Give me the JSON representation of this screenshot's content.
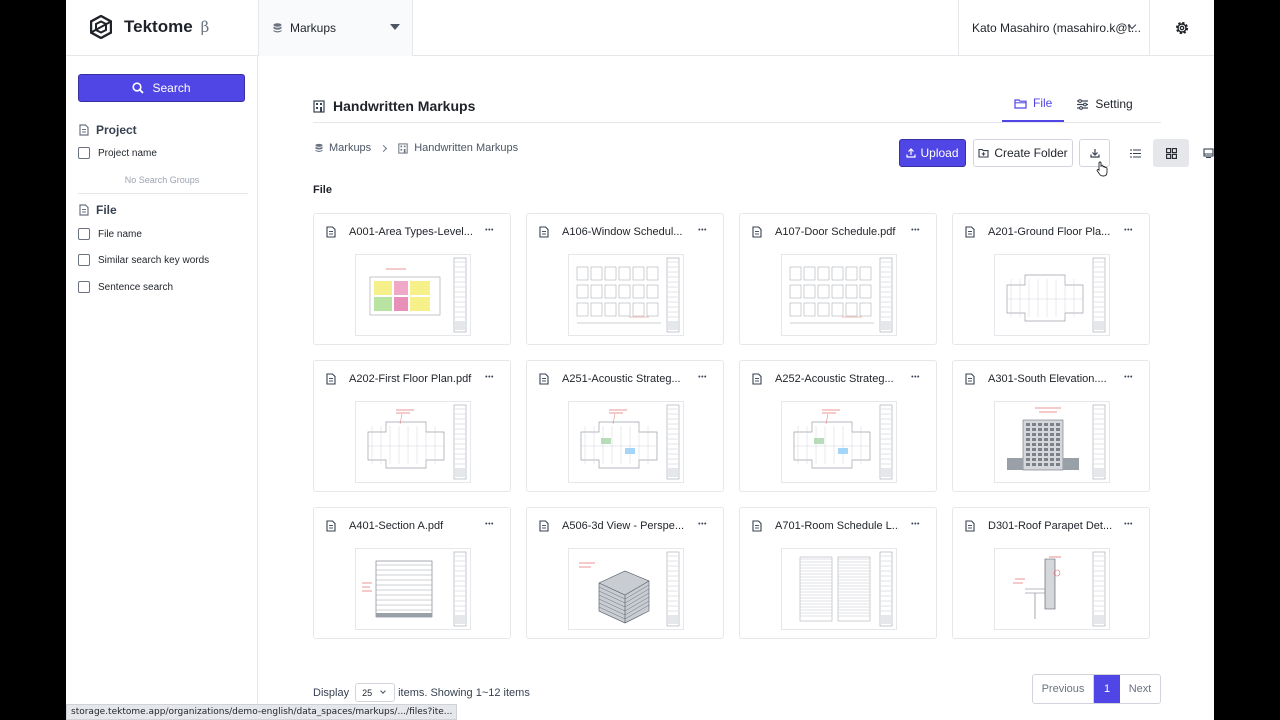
{
  "header": {
    "app_name": "Tektome",
    "beta_mark": "β",
    "data_space": "Markups",
    "user": "Kato Masahiro (masahiro.k@t..."
  },
  "sidebar": {
    "search_label": "Search",
    "project_heading": "Project",
    "project_options": [
      "Project name"
    ],
    "no_groups": "No Search Groups",
    "file_heading": "File",
    "file_options": [
      "File name",
      "Similar search key words",
      "Sentence search"
    ]
  },
  "main": {
    "title": "Handwritten Markups",
    "tabs": [
      {
        "label": "File",
        "active": true,
        "icon": "folder-icon"
      },
      {
        "label": "Setting",
        "active": false,
        "icon": "sliders-icon"
      }
    ],
    "breadcrumb": [
      "Markups",
      "Handwritten Markups"
    ],
    "upload_label": "Upload",
    "create_folder_label": "Create Folder",
    "active_view": "grid",
    "section_label": "File",
    "files": [
      {
        "name": "A001-Area Types-Level...",
        "thumb": "color-plan"
      },
      {
        "name": "A106-Window Schedul...",
        "thumb": "schedule-sheet"
      },
      {
        "name": "A107-Door Schedule.pdf",
        "thumb": "schedule-sheet"
      },
      {
        "name": "A201-Ground Floor Pla...",
        "thumb": "floor-plan"
      },
      {
        "name": "A202-First Floor Plan.pdf",
        "thumb": "floor-plan-marked"
      },
      {
        "name": "A251-Acoustic Strateg...",
        "thumb": "floor-plan-color"
      },
      {
        "name": "A252-Acoustic Strateg...",
        "thumb": "floor-plan-color"
      },
      {
        "name": "A301-South Elevation....",
        "thumb": "elevation"
      },
      {
        "name": "A401-Section A.pdf",
        "thumb": "section"
      },
      {
        "name": "A506-3d View - Perspe...",
        "thumb": "3d-view"
      },
      {
        "name": "A701-Room Schedule L...",
        "thumb": "table-sheet"
      },
      {
        "name": "D301-Roof Parapet Det...",
        "thumb": "detail"
      }
    ],
    "display_label": "Display",
    "per_page": "25",
    "items_text": "items. Showing 1~12 items",
    "pager": {
      "prev": "Previous",
      "current": "1",
      "next": "Next"
    }
  },
  "status_url": "storage.tektome.app/organizations/demo-english/data_spaces/markups/.../files?ite...",
  "colors": {
    "accent": "#4f46e5",
    "border": "#e5e7eb"
  }
}
